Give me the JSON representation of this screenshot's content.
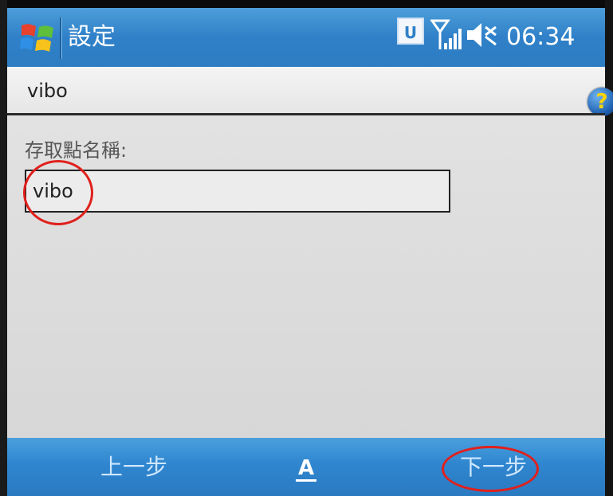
{
  "titlebar": {
    "app_title": "設定",
    "status_u": "U",
    "clock": "06:34"
  },
  "subtitle_bar": {
    "subtitle": "vibo",
    "help_symbol": "?"
  },
  "form": {
    "access_point_label": "存取點名稱:",
    "access_point_value": "vibo"
  },
  "softkeys": {
    "back": "上一步",
    "next": "下一步",
    "sip_label": "A"
  },
  "colors": {
    "titlebar_blue": "#2f80c8",
    "annotation_red": "#e0201c"
  },
  "icons": [
    "windows-start-icon",
    "u-status-icon",
    "signal-icon",
    "volume-muted-icon",
    "help-icon",
    "keyboard-input-icon"
  ]
}
